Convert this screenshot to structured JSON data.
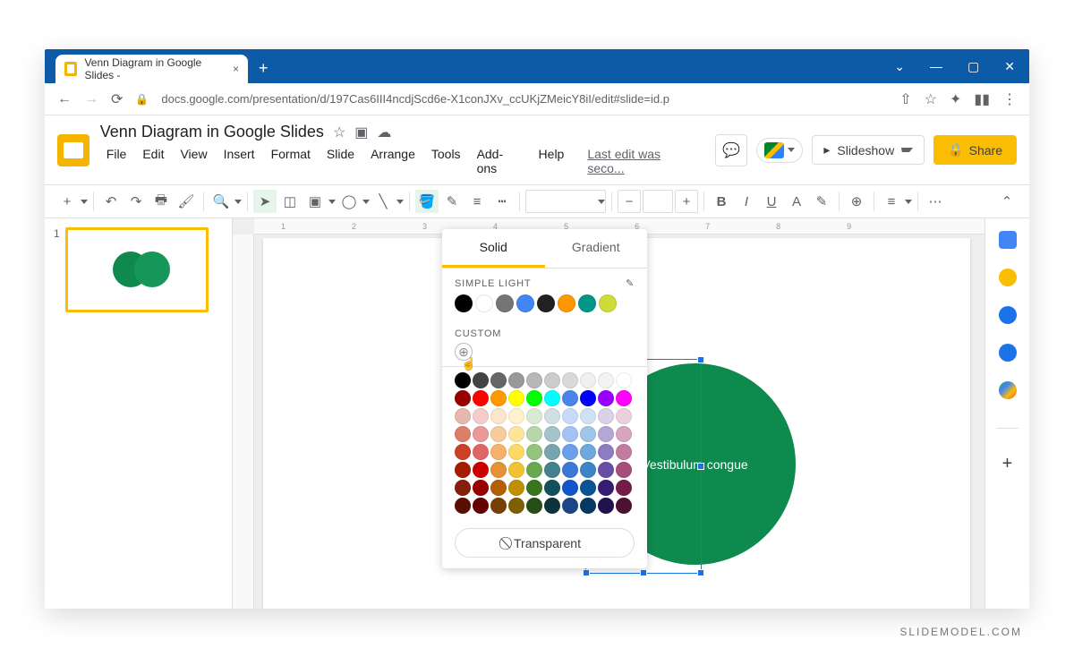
{
  "browser": {
    "tab_title": "Venn Diagram in Google Slides -",
    "url": "docs.google.com/presentation/d/197Cas6III4ncdjScd6e-X1conJXv_ccUKjZMeicY8iI/edit#slide=id.p"
  },
  "doc": {
    "title": "Venn Diagram in Google Slides",
    "menus": [
      "File",
      "Edit",
      "View",
      "Insert",
      "Format",
      "Slide",
      "Arrange",
      "Tools",
      "Add-ons",
      "Help"
    ],
    "last_edit": "Last edit was seco...",
    "slideshow": "Slideshow",
    "share": "Share"
  },
  "thumbnail": {
    "number": "1"
  },
  "shape_text": "Vestibulum congue",
  "color_popover": {
    "tab_solid": "Solid",
    "tab_gradient": "Gradient",
    "section_theme": "SIMPLE LIGHT",
    "section_custom": "CUSTOM",
    "transparent": "Transparent",
    "theme_colors": [
      "#000000",
      "#ffffff",
      "#757575",
      "#4285f4",
      "#212121",
      "#ff9800",
      "#009688",
      "#cddc39"
    ],
    "palette": [
      "#000000",
      "#434343",
      "#666666",
      "#999999",
      "#b7b7b7",
      "#cccccc",
      "#d9d9d9",
      "#efefef",
      "#f3f3f3",
      "#ffffff",
      "#980000",
      "#ff0000",
      "#ff9900",
      "#ffff00",
      "#00ff00",
      "#00ffff",
      "#4a86e8",
      "#0000ff",
      "#9900ff",
      "#ff00ff",
      "#e6b8af",
      "#f4cccc",
      "#fce5cd",
      "#fff2cc",
      "#d9ead3",
      "#d0e0e3",
      "#c9daf8",
      "#cfe2f3",
      "#d9d2e9",
      "#ead1dc",
      "#dd7e6b",
      "#ea9999",
      "#f9cb9c",
      "#ffe599",
      "#b6d7a8",
      "#a2c4c9",
      "#a4c2f4",
      "#9fc5e8",
      "#b4a7d6",
      "#d5a6bd",
      "#cc4125",
      "#e06666",
      "#f6b26b",
      "#ffd966",
      "#93c47d",
      "#76a5af",
      "#6d9eeb",
      "#6fa8dc",
      "#8e7cc3",
      "#c27ba0",
      "#a61c00",
      "#cc0000",
      "#e69138",
      "#f1c232",
      "#6aa84f",
      "#45818e",
      "#3c78d8",
      "#3d85c6",
      "#674ea7",
      "#a64d79",
      "#85200c",
      "#990000",
      "#b45f06",
      "#bf9000",
      "#38761d",
      "#134f5c",
      "#1155cc",
      "#0b5394",
      "#351c75",
      "#741b47",
      "#5b0f00",
      "#660000",
      "#783f04",
      "#7f6000",
      "#274e13",
      "#0c343d",
      "#1c4587",
      "#073763",
      "#20124d",
      "#4c1130"
    ]
  },
  "ruler": [
    "1",
    "2",
    "3",
    "4",
    "5",
    "6",
    "7",
    "8",
    "9"
  ],
  "watermark": "SLIDEMODEL.COM"
}
